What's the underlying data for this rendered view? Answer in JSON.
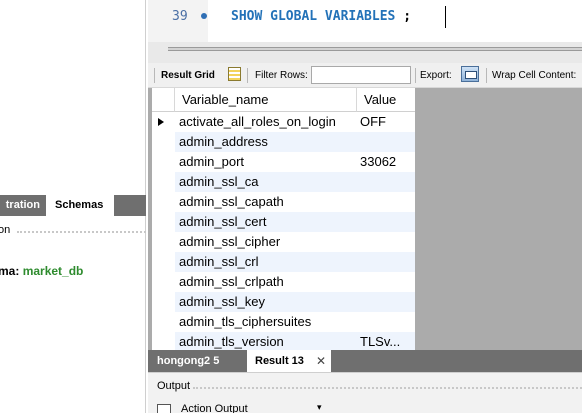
{
  "editor": {
    "line_number": "39",
    "code": "SHOW GLOBAL VARIABLES",
    "terminator": ";"
  },
  "left_pane": {
    "tab_administration": "tration",
    "tab_schemas": "Schemas",
    "section_label": "on",
    "schema_label": "ma:",
    "schema_name": "market_db"
  },
  "toolbar": {
    "result_grid": "Result Grid",
    "filter_rows_label": "Filter Rows:",
    "filter_rows_value": "",
    "export_label": "Export:",
    "wrap_label": "Wrap Cell Content:"
  },
  "grid": {
    "columns": [
      "Variable_name",
      "Value"
    ],
    "rows": [
      {
        "name": "activate_all_roles_on_login",
        "value": "OFF"
      },
      {
        "name": "admin_address",
        "value": ""
      },
      {
        "name": "admin_port",
        "value": "33062"
      },
      {
        "name": "admin_ssl_ca",
        "value": ""
      },
      {
        "name": "admin_ssl_capath",
        "value": ""
      },
      {
        "name": "admin_ssl_cert",
        "value": ""
      },
      {
        "name": "admin_ssl_cipher",
        "value": ""
      },
      {
        "name": "admin_ssl_crl",
        "value": ""
      },
      {
        "name": "admin_ssl_crlpath",
        "value": ""
      },
      {
        "name": "admin_ssl_key",
        "value": ""
      },
      {
        "name": "admin_tls_ciphersuites",
        "value": ""
      },
      {
        "name": "admin_tls_version",
        "value": "TLSv..."
      }
    ]
  },
  "result_tabs": {
    "tab1": "hongong2 5",
    "tab2": "Result 13",
    "close": "✕"
  },
  "output": {
    "label": "Output",
    "selector": "Action Output",
    "chevron": "▾"
  }
}
